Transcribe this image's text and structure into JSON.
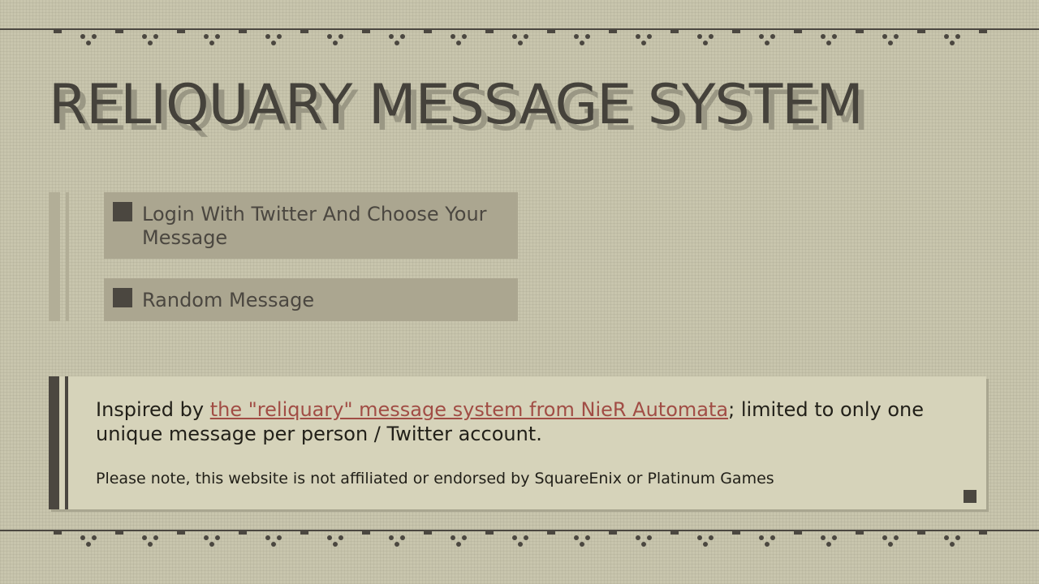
{
  "app": {
    "title": "RELIQUARY MESSAGE SYSTEM"
  },
  "menu": {
    "items": [
      {
        "label": "Login With Twitter And Choose Your Message",
        "icon": "square-bullet-icon"
      },
      {
        "label": "Random Message",
        "icon": "square-bullet-icon"
      }
    ]
  },
  "info": {
    "text_before": "Inspired by ",
    "link_text": "the \"reliquary\" message system from NieR Automata",
    "text_after": "; limited to only one unique message per person / Twitter account.",
    "note": "Please note, this website is not affiliated or endorsed by SquareEnix or Platinum Games"
  },
  "colors": {
    "background": "#c8c5ad",
    "ink": "#4b4740",
    "button": "#aba690",
    "panel": "#d6d3ba",
    "link": "#a14d45"
  }
}
